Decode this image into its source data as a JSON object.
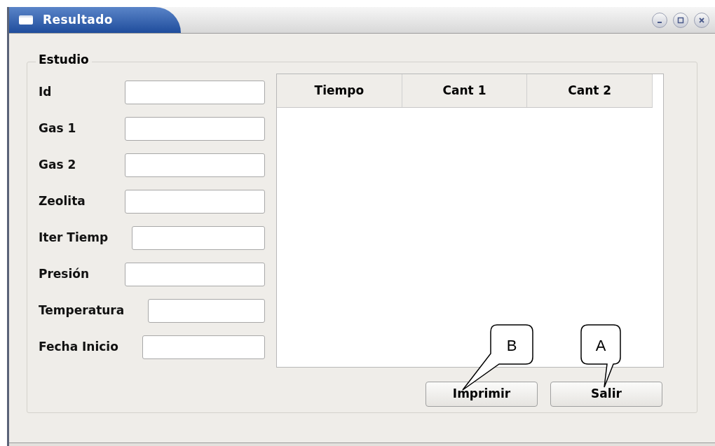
{
  "window": {
    "title": "Resultado"
  },
  "group": {
    "title": "Estudio",
    "fields": [
      {
        "label": "Id"
      },
      {
        "label": "Gas 1"
      },
      {
        "label": "Gas 2"
      },
      {
        "label": "Zeolita"
      },
      {
        "label": "Iter Tiemp"
      },
      {
        "label": "Presión"
      },
      {
        "label": "Temperatura"
      },
      {
        "label": "Fecha Inicio"
      }
    ]
  },
  "table": {
    "columns": [
      "Tiempo",
      "Cant 1",
      "Cant 2"
    ]
  },
  "buttons": [
    "Imprimir",
    "Salir"
  ],
  "callouts": [
    "B",
    "A"
  ]
}
